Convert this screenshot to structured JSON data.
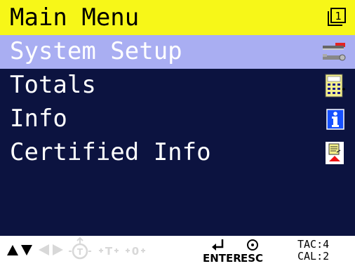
{
  "header": {
    "title": "Main Menu",
    "screen_number": "1",
    "background_color": "#f7f718"
  },
  "menu": {
    "items": [
      {
        "label": "System Setup",
        "icon": "wrench-icon",
        "selected": true
      },
      {
        "label": "Totals",
        "icon": "calculator-icon",
        "selected": false
      },
      {
        "label": "Info",
        "icon": "info-icon",
        "selected": false
      },
      {
        "label": "Certified Info",
        "icon": "certified-document-icon",
        "selected": false
      }
    ],
    "selected_color": "#a9aef2",
    "background_color": "#0c1340"
  },
  "footer": {
    "enter_label": "ENTER",
    "esc_label": "ESC",
    "tac": "TAC:4",
    "cal": "CAL:2"
  }
}
